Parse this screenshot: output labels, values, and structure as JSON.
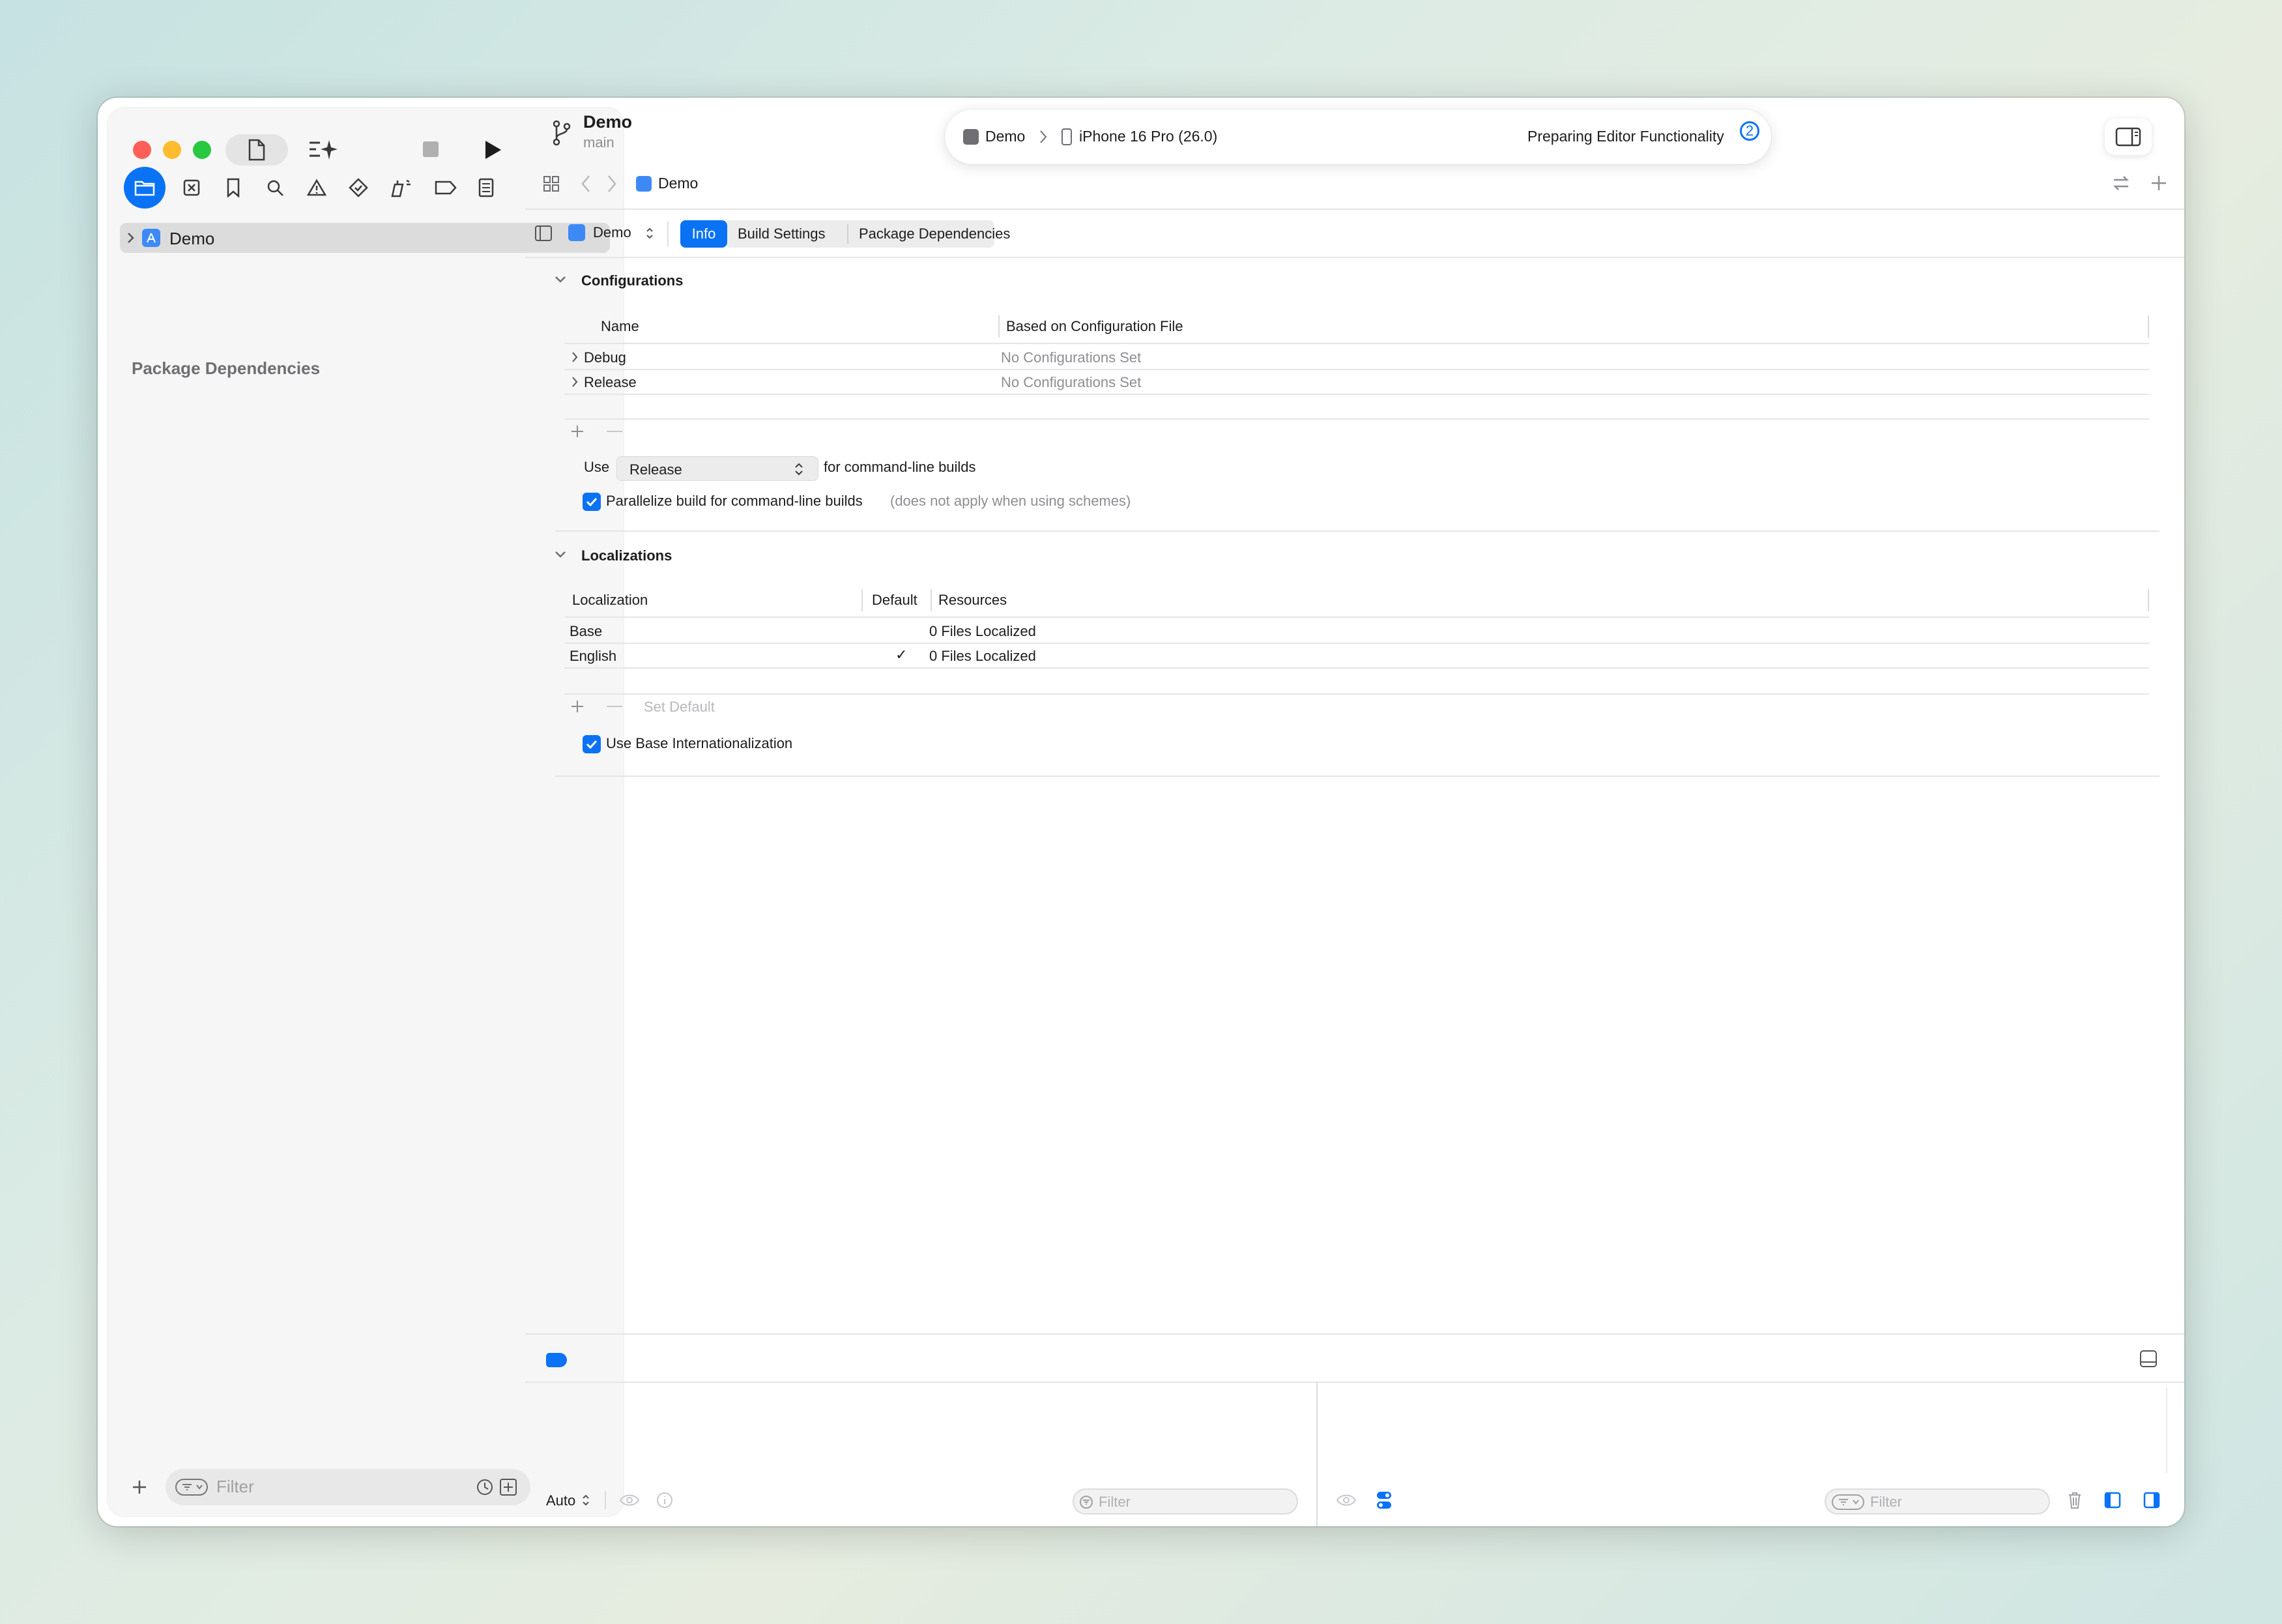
{
  "sidebar": {
    "project_item": "Demo",
    "section_title": "Package Dependencies",
    "filter_placeholder": "Filter"
  },
  "header": {
    "project_name": "Demo",
    "branch": "main",
    "scheme": "Demo",
    "destination": "iPhone 16 Pro (26.0)",
    "status": "Preparing Editor Functionality",
    "status_count": "2"
  },
  "jumpbar": {
    "crumb": "Demo"
  },
  "editor": {
    "target_selector": "Demo",
    "tabs": [
      "Info",
      "Build Settings",
      "Package Dependencies"
    ],
    "configurations": {
      "title": "Configurations",
      "col_name": "Name",
      "col_file": "Based on Configuration File",
      "rows": [
        {
          "name": "Debug",
          "file": "No Configurations Set"
        },
        {
          "name": "Release",
          "file": "No Configurations Set"
        }
      ],
      "use_label": "Use",
      "use_value": "Release",
      "use_suffix": "for command-line builds",
      "parallelize_label": "Parallelize build for command-line builds",
      "parallelize_note": "(does not apply when using schemes)"
    },
    "localizations": {
      "title": "Localizations",
      "col_loc": "Localization",
      "col_default": "Default",
      "col_resources": "Resources",
      "rows": [
        {
          "name": "Base",
          "default": "",
          "resources": "0 Files Localized"
        },
        {
          "name": "English",
          "default": "✓",
          "resources": "0 Files Localized"
        }
      ],
      "set_default": "Set Default",
      "base_intl_label": "Use Base Internationalization"
    }
  },
  "debug": {
    "auto_label": "Auto",
    "filter_left": "Filter",
    "filter_right": "Filter"
  },
  "colors": {
    "accent": "#0a72f5",
    "close": "#ff5f57",
    "minimize": "#febc2e",
    "zoom": "#28c840"
  }
}
